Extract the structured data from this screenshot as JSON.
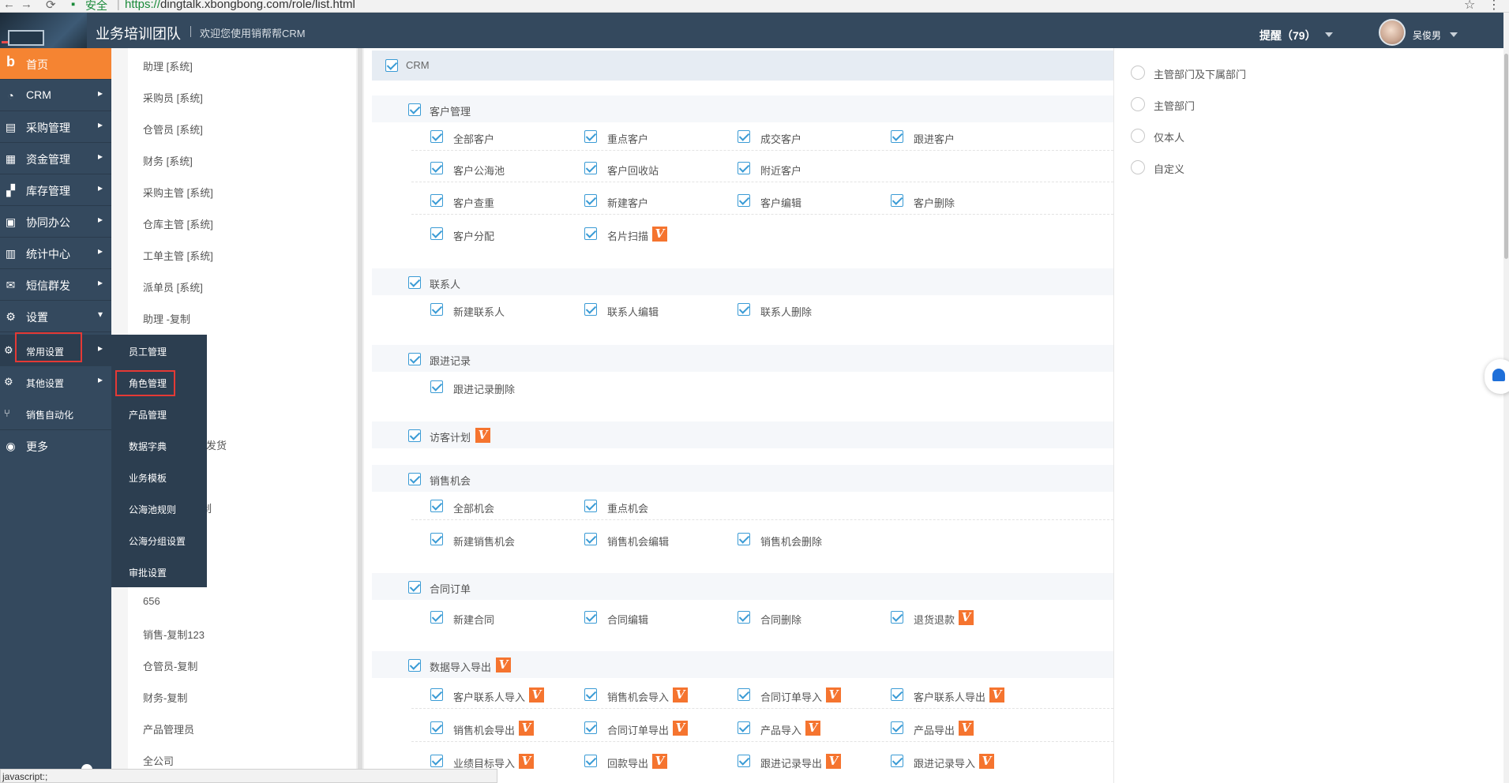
{
  "browser": {
    "back": "←",
    "forward": "→",
    "reload": "⟳",
    "secure_label": "安全",
    "url_scheme": "https://",
    "url_rest": "dingtalk.xbongbong.com/role/list.html",
    "star": "☆",
    "menu": "⋮",
    "status_text": "javascript:;"
  },
  "header": {
    "team_name": "业务培训团队",
    "welcome": "欢迎您使用销帮帮CRM",
    "reminder": "提醒（79）",
    "username": "吴俊男"
  },
  "sidebar": {
    "items": [
      {
        "label": "首页",
        "icon": "b"
      },
      {
        "label": "CRM",
        "icon": "◔"
      },
      {
        "label": "采购管理",
        "icon": "▤"
      },
      {
        "label": "资金管理",
        "icon": "▦"
      },
      {
        "label": "库存管理",
        "icon": "▞"
      },
      {
        "label": "协同办公",
        "icon": "▣"
      },
      {
        "label": "统计中心",
        "icon": "▥"
      },
      {
        "label": "短信群发",
        "icon": "✉"
      },
      {
        "label": "设置",
        "icon": "⚙"
      }
    ],
    "sub_items": [
      {
        "label": "常用设置",
        "icon": "⚙"
      },
      {
        "label": "其他设置",
        "icon": "⚙"
      },
      {
        "label": "销售自动化",
        "icon": "⑂"
      },
      {
        "label": "更多",
        "icon": "◉"
      }
    ],
    "arrow_right": "▸",
    "arrow_down": "▾"
  },
  "flyout": {
    "items": [
      "员工管理",
      "角色管理",
      "产品管理",
      "数据字典",
      "业务模板",
      "公海池规则",
      "公海分组设置",
      "审批设置"
    ]
  },
  "roles": {
    "items": [
      "助理 [系统]",
      "采购员 [系统]",
      "仓管员 [系统]",
      "财务 [系统]",
      "采购主管 [系统]",
      "仓库主管 [系统]",
      "工单主管 [系统]",
      "派单员 [系统]",
      "助理 -复制"
    ],
    "partial_items": [
      "划发货",
      "制"
    ],
    "bottom_items": [
      "656",
      "销售-复制123",
      "仓管员-复制",
      "财务-复制",
      "产品管理员",
      "全公司"
    ]
  },
  "permissions": {
    "root": "CRM",
    "v_badge": "V",
    "groups": [
      {
        "name": "客户管理",
        "rows": [
          [
            {
              "label": "全部客户"
            },
            {
              "label": "重点客户"
            },
            {
              "label": "成交客户"
            },
            {
              "label": "跟进客户"
            }
          ],
          [
            {
              "label": "客户公海池"
            },
            {
              "label": "客户回收站"
            },
            {
              "label": "附近客户"
            }
          ],
          [
            {
              "label": "客户查重"
            },
            {
              "label": "新建客户"
            },
            {
              "label": "客户编辑"
            },
            {
              "label": "客户删除"
            }
          ],
          [
            {
              "label": "客户分配"
            },
            {
              "label": "名片扫描",
              "v": true
            }
          ]
        ]
      },
      {
        "name": "联系人",
        "rows": [
          [
            {
              "label": "新建联系人"
            },
            {
              "label": "联系人编辑"
            },
            {
              "label": "联系人删除"
            }
          ]
        ]
      },
      {
        "name": "跟进记录",
        "rows": [
          [
            {
              "label": "跟进记录删除"
            }
          ]
        ]
      },
      {
        "name": "访客计划",
        "v": true,
        "rows": []
      },
      {
        "name": "销售机会",
        "rows": [
          [
            {
              "label": "全部机会"
            },
            {
              "label": "重点机会"
            }
          ],
          [
            {
              "label": "新建销售机会"
            },
            {
              "label": "销售机会编辑"
            },
            {
              "label": "销售机会删除"
            }
          ]
        ]
      },
      {
        "name": "合同订单",
        "rows": [
          [
            {
              "label": "新建合同"
            },
            {
              "label": "合同编辑"
            },
            {
              "label": "合同删除"
            },
            {
              "label": "退货退款",
              "v": true
            }
          ]
        ]
      },
      {
        "name": "数据导入导出",
        "v": true,
        "rows": [
          [
            {
              "label": "客户联系人导入",
              "v": true
            },
            {
              "label": "销售机会导入",
              "v": true
            },
            {
              "label": "合同订单导入",
              "v": true
            },
            {
              "label": "客户联系人导出",
              "v": true
            }
          ],
          [
            {
              "label": "销售机会导出",
              "v": true
            },
            {
              "label": "合同订单导出",
              "v": true
            },
            {
              "label": "产品导入",
              "v": true
            },
            {
              "label": "产品导出",
              "v": true
            }
          ],
          [
            {
              "label": "业绩目标导入",
              "v": true
            },
            {
              "label": "回款导出",
              "v": true
            },
            {
              "label": "跟进记录导出",
              "v": true
            },
            {
              "label": "跟进记录导入",
              "v": true
            }
          ]
        ]
      }
    ]
  },
  "data_scope": {
    "options": [
      "主管部门及下属部门",
      "主管部门",
      "仅本人",
      "自定义"
    ]
  },
  "colors": {
    "header_bg": "#34495e",
    "active_orange": "#f58432",
    "checkbox_blue": "#3a9bd5",
    "badge_orange": "#f5742f",
    "highlight_red": "#e53935"
  }
}
